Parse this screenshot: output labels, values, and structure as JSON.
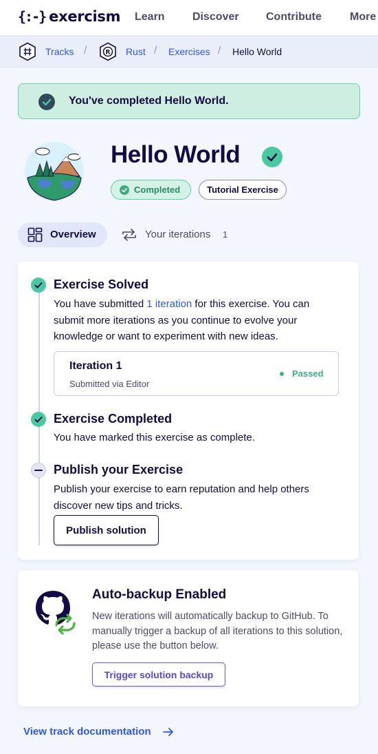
{
  "topnav": {
    "logo_mark": "{:-}",
    "logo_text": "exercism",
    "links": [
      "Learn",
      "Discover",
      "Contribute",
      "More"
    ]
  },
  "breadcrumb": {
    "items": [
      "Tracks",
      "Rust",
      "Exercises",
      "Hello World"
    ],
    "separator": "/"
  },
  "banner": {
    "text": "You've completed Hello World."
  },
  "exercise": {
    "title": "Hello World",
    "status_pill": "Completed",
    "type_pill": "Tutorial Exercise"
  },
  "tabs": {
    "overview": "Overview",
    "iterations": "Your iterations",
    "iterations_count": "1"
  },
  "steps": {
    "solved": {
      "title": "Exercise Solved",
      "text_before": "You have submitted ",
      "link": "1 iteration",
      "text_after": " for this exercise. You can submit more iterations as you continue to evolve your knowledge or want to experiment with new ideas."
    },
    "iteration": {
      "name": "Iteration 1",
      "subtitle": "Submitted via Editor",
      "status": "Passed"
    },
    "completed": {
      "title": "Exercise Completed",
      "text": "You have marked this exercise as complete."
    },
    "publish": {
      "title": "Publish your Exercise",
      "text": "Publish your exercise to earn reputation and help others discover new tips and tricks.",
      "button": "Publish solution"
    }
  },
  "backup": {
    "title": "Auto-backup Enabled",
    "text": "New iterations will automatically backup to GitHub. To manually trigger a backup of all iterations to this solution, please use the button below.",
    "button": "Trigger solution backup"
  },
  "footer_link": "View track documentation",
  "colors": {
    "brand_dark": "#130b43",
    "link_blue": "#2e57e8",
    "success_green": "#4ac9a0",
    "banner_bg": "#cfeee2",
    "backup_purple": "#5a48c8"
  },
  "icons": [
    "tracks-hex-icon",
    "rust-hex-icon",
    "check-icon",
    "overview-grid-icon",
    "iterations-icon",
    "github-icon",
    "sync-icon",
    "arrow-right-icon"
  ]
}
